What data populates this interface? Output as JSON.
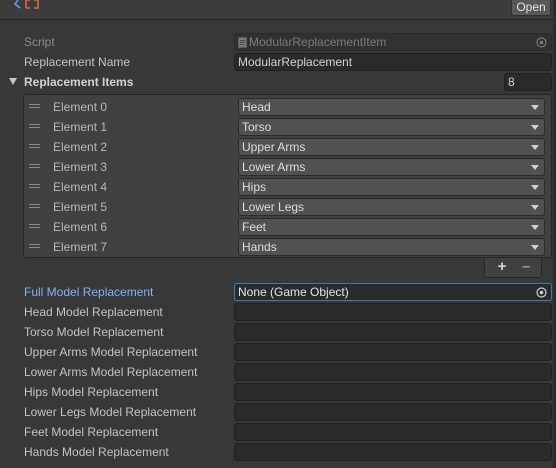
{
  "header": {
    "open_label": "Open",
    "script_icon": "script-icon"
  },
  "script_row": {
    "label": "Script",
    "value": "ModularReplacementItem"
  },
  "replacement_name": {
    "label": "Replacement Name",
    "value": "ModularReplacement"
  },
  "replacement_items": {
    "label": "Replacement Items",
    "count": "8",
    "elements": [
      {
        "label": "Element 0",
        "value": "Head"
      },
      {
        "label": "Element 1",
        "value": "Torso"
      },
      {
        "label": "Element 2",
        "value": "Upper Arms"
      },
      {
        "label": "Element 3",
        "value": "Lower Arms"
      },
      {
        "label": "Element 4",
        "value": "Hips"
      },
      {
        "label": "Element 5",
        "value": "Lower Legs"
      },
      {
        "label": "Element 6",
        "value": "Feet"
      },
      {
        "label": "Element 7",
        "value": "Hands"
      }
    ],
    "add_label": "+",
    "remove_label": "–"
  },
  "full_model": {
    "label": "Full Model Replacement",
    "value": "None (Game Object)"
  },
  "model_fields": [
    {
      "label": "Head Model Replacement",
      "value": ""
    },
    {
      "label": "Torso Model Replacement",
      "value": ""
    },
    {
      "label": "Upper Arms Model Replacement",
      "value": ""
    },
    {
      "label": "Lower Arms Model Replacement",
      "value": ""
    },
    {
      "label": "Hips Model Replacement",
      "value": ""
    },
    {
      "label": "Lower Legs Model Replacement",
      "value": ""
    },
    {
      "label": "Feet Model Replacement",
      "value": ""
    },
    {
      "label": "Hands Model Replacement",
      "value": ""
    }
  ],
  "colors": {
    "background": "#383838",
    "accent_label": "#7cb4f4",
    "focus_border": "#3a79bb"
  }
}
